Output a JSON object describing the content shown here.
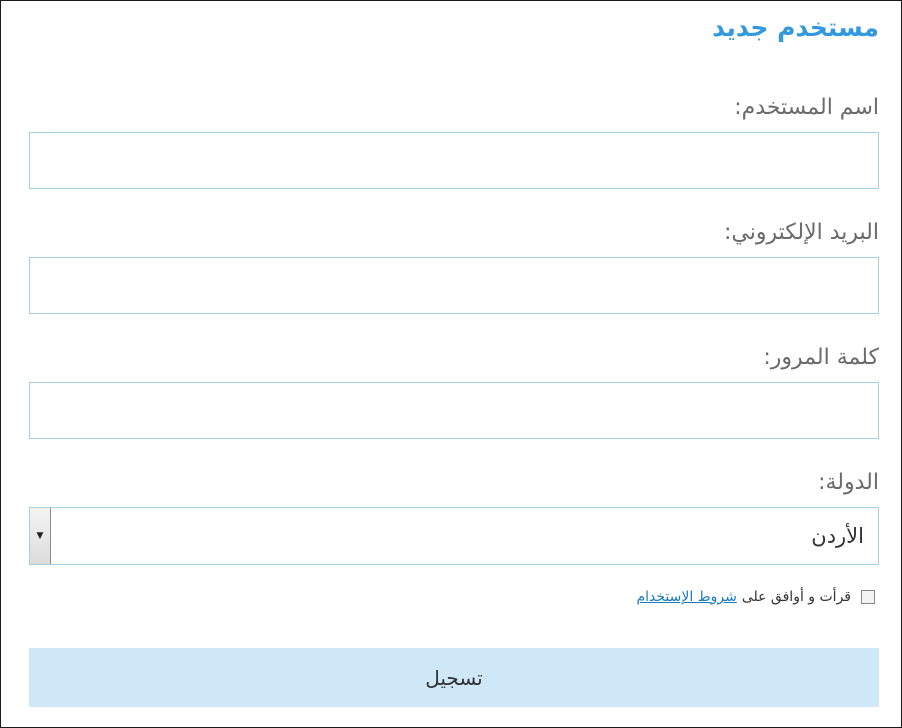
{
  "form": {
    "title": "مستخدم جديد",
    "username_label": "اسم المستخدم:",
    "username_value": "",
    "email_label": "البريد الإلكتروني:",
    "email_value": "",
    "password_label": "كلمة المرور:",
    "password_value": "",
    "country_label": "الدولة:",
    "country_selected": "الأردن",
    "terms_prefix": "قرأت و أوافق على",
    "terms_link": "شروط الإستخدام",
    "terms_checked": false,
    "submit_label": "تسجيل"
  },
  "colors": {
    "title": "#3399dd",
    "label": "#6b6b6b",
    "field_border": "#a9cde3",
    "button_bg": "#cfe8f8",
    "link": "#1a7bbf"
  },
  "icons": {
    "select_arrow": "chevron-down-icon"
  }
}
